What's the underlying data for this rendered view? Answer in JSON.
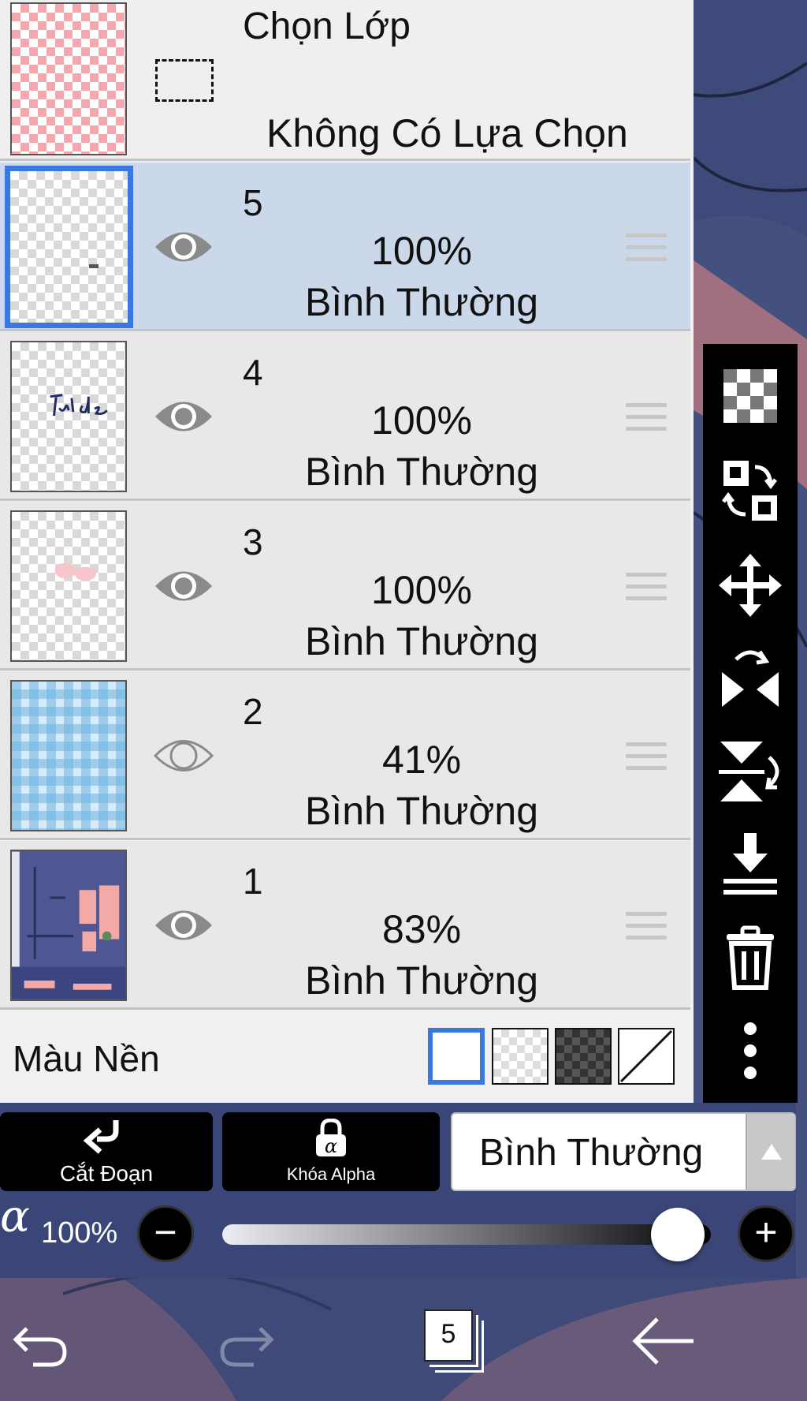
{
  "header": {
    "title": "Chọn Lớp",
    "selection_status": "Không Có Lựa Chọn"
  },
  "layers": [
    {
      "name": "5",
      "opacity": "100%",
      "blend": "Bình Thường",
      "visible": true,
      "selected": true
    },
    {
      "name": "4",
      "opacity": "100%",
      "blend": "Bình Thường",
      "visible": true,
      "selected": false
    },
    {
      "name": "3",
      "opacity": "100%",
      "blend": "Bình Thường",
      "visible": true,
      "selected": false
    },
    {
      "name": "2",
      "opacity": "41%",
      "blend": "Bình Thường",
      "visible": false,
      "selected": false
    },
    {
      "name": "1",
      "opacity": "83%",
      "blend": "Bình Thường",
      "visible": true,
      "selected": false
    }
  ],
  "background": {
    "label": "Màu Nền",
    "options": [
      "white",
      "transparent-light",
      "transparent-dark",
      "none"
    ],
    "selected": "white"
  },
  "toolbar_icons": [
    "new-layer-icon",
    "swap-layers-icon",
    "move-icon",
    "flip-horizontal-icon",
    "flip-vertical-icon",
    "merge-down-icon",
    "trash-icon",
    "more-icon"
  ],
  "actions": {
    "clipping_label": "Cắt Đoạn",
    "alpha_lock_label": "Khóa Alpha",
    "blend_mode": "Bình Thường"
  },
  "opacity": {
    "symbol": "α",
    "value": "100%",
    "fraction": 1.0
  },
  "nav": {
    "layer_count": "5"
  },
  "colors": {
    "accent": "#3a78e0",
    "selected_row": "#cbd8ea",
    "toolbar": "#000000"
  }
}
